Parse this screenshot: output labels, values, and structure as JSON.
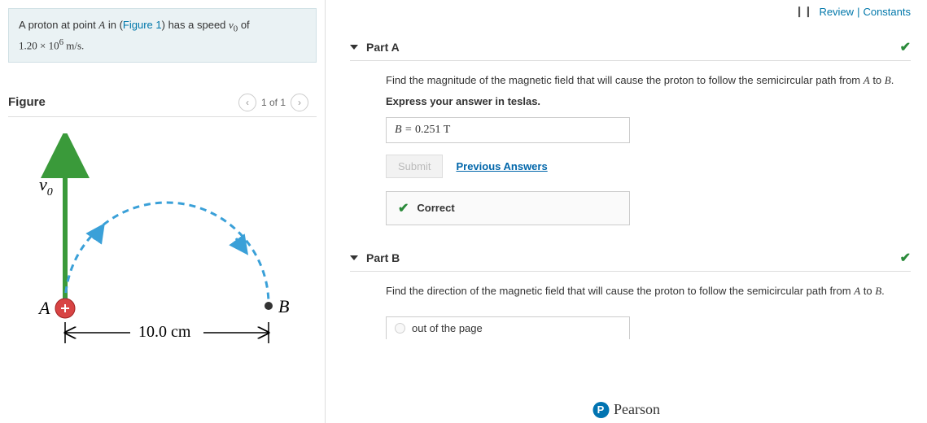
{
  "topLinks": {
    "review": "Review",
    "sep": "|",
    "constants": "Constants"
  },
  "problem": {
    "pre": "A proton at point ",
    "A": "A",
    "mid": " in (",
    "figLink": "Figure 1",
    "post1": ") has a speed ",
    "v0": "v",
    "v0sub": "0",
    "post2": " of ",
    "value": "1.20 × 10",
    "exp": "6",
    "units": " m/s."
  },
  "figure": {
    "title": "Figure",
    "pager": "1 of 1",
    "labels": {
      "v0": "v",
      "v0sub": "0",
      "A": "A",
      "B": "B",
      "dist": "10.0 cm"
    }
  },
  "partA": {
    "title": "Part A",
    "q_pre": "Find the magnitude of the magnetic field that will cause the proton to follow the semicircular path from ",
    "q_A": "A",
    "q_mid": " to ",
    "q_B": "B",
    "q_post": ".",
    "instruction": "Express your answer in teslas.",
    "answer_prefix": "B = ",
    "answer_value": "0.251",
    "answer_unit": "  T",
    "submit": "Submit",
    "prevAnswers": "Previous Answers",
    "feedback": "Correct"
  },
  "partB": {
    "title": "Part B",
    "q_pre": "Find the direction of the magnetic field that will cause the proton to follow the semicircular path from ",
    "q_A": "A",
    "q_mid": " to ",
    "q_B": "B",
    "q_post": ".",
    "option1": "out of the page"
  },
  "footer": {
    "brand": "Pearson",
    "logo": "P"
  }
}
